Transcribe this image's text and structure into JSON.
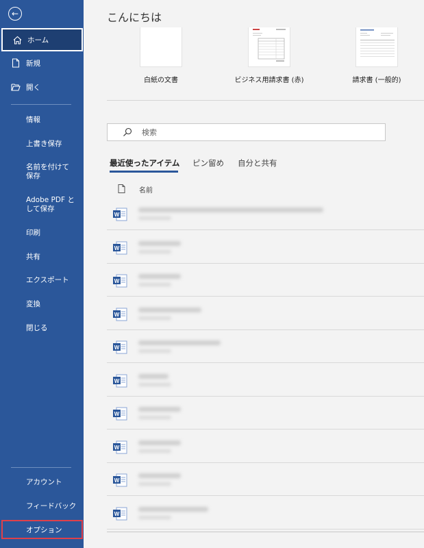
{
  "sidebar": {
    "back_icon": "back-arrow-icon",
    "home": "ホーム",
    "new": "新規",
    "open": "開く",
    "info": "情報",
    "save": "上書き保存",
    "save_as": "名前を付けて保存",
    "save_pdf": "Adobe PDF として保存",
    "print": "印刷",
    "share": "共有",
    "export": "エクスポート",
    "transform": "変換",
    "close": "閉じる",
    "account": "アカウント",
    "feedback": "フィードバック",
    "options": "オプション"
  },
  "main": {
    "greeting": "こんにちは",
    "templates": [
      {
        "label": "白紙の文書"
      },
      {
        "label": "ビジネス用請求書 (赤)"
      },
      {
        "label": "請求書 (一般的)"
      }
    ],
    "search_placeholder": "検索",
    "tabs": [
      "最近使ったアイテム",
      "ピン留め",
      "自分と共有"
    ],
    "column_name": "名前",
    "file_count": 10
  },
  "colors": {
    "sidebar": "#2b579a",
    "home_selected": "#1e3f72",
    "options_highlight": "#e0404a",
    "word_icon": "#2b579a"
  }
}
